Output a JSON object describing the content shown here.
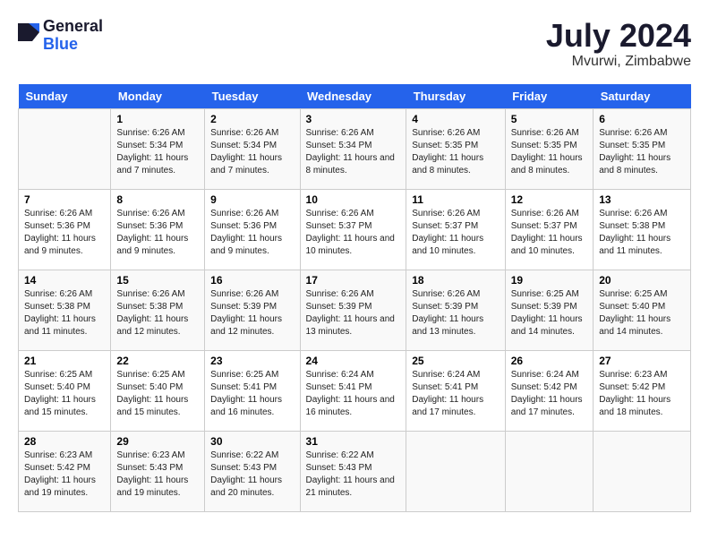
{
  "header": {
    "logo_general": "General",
    "logo_blue": "Blue",
    "month_year": "July 2024",
    "location": "Mvurwi, Zimbabwe"
  },
  "days_of_week": [
    "Sunday",
    "Monday",
    "Tuesday",
    "Wednesday",
    "Thursday",
    "Friday",
    "Saturday"
  ],
  "weeks": [
    [
      {
        "day": "",
        "sunrise": "",
        "sunset": "",
        "daylight": ""
      },
      {
        "day": "1",
        "sunrise": "Sunrise: 6:26 AM",
        "sunset": "Sunset: 5:34 PM",
        "daylight": "Daylight: 11 hours and 7 minutes."
      },
      {
        "day": "2",
        "sunrise": "Sunrise: 6:26 AM",
        "sunset": "Sunset: 5:34 PM",
        "daylight": "Daylight: 11 hours and 7 minutes."
      },
      {
        "day": "3",
        "sunrise": "Sunrise: 6:26 AM",
        "sunset": "Sunset: 5:34 PM",
        "daylight": "Daylight: 11 hours and 8 minutes."
      },
      {
        "day": "4",
        "sunrise": "Sunrise: 6:26 AM",
        "sunset": "Sunset: 5:35 PM",
        "daylight": "Daylight: 11 hours and 8 minutes."
      },
      {
        "day": "5",
        "sunrise": "Sunrise: 6:26 AM",
        "sunset": "Sunset: 5:35 PM",
        "daylight": "Daylight: 11 hours and 8 minutes."
      },
      {
        "day": "6",
        "sunrise": "Sunrise: 6:26 AM",
        "sunset": "Sunset: 5:35 PM",
        "daylight": "Daylight: 11 hours and 8 minutes."
      }
    ],
    [
      {
        "day": "7",
        "sunrise": "Sunrise: 6:26 AM",
        "sunset": "Sunset: 5:36 PM",
        "daylight": "Daylight: 11 hours and 9 minutes."
      },
      {
        "day": "8",
        "sunrise": "Sunrise: 6:26 AM",
        "sunset": "Sunset: 5:36 PM",
        "daylight": "Daylight: 11 hours and 9 minutes."
      },
      {
        "day": "9",
        "sunrise": "Sunrise: 6:26 AM",
        "sunset": "Sunset: 5:36 PM",
        "daylight": "Daylight: 11 hours and 9 minutes."
      },
      {
        "day": "10",
        "sunrise": "Sunrise: 6:26 AM",
        "sunset": "Sunset: 5:37 PM",
        "daylight": "Daylight: 11 hours and 10 minutes."
      },
      {
        "day": "11",
        "sunrise": "Sunrise: 6:26 AM",
        "sunset": "Sunset: 5:37 PM",
        "daylight": "Daylight: 11 hours and 10 minutes."
      },
      {
        "day": "12",
        "sunrise": "Sunrise: 6:26 AM",
        "sunset": "Sunset: 5:37 PM",
        "daylight": "Daylight: 11 hours and 10 minutes."
      },
      {
        "day": "13",
        "sunrise": "Sunrise: 6:26 AM",
        "sunset": "Sunset: 5:38 PM",
        "daylight": "Daylight: 11 hours and 11 minutes."
      }
    ],
    [
      {
        "day": "14",
        "sunrise": "Sunrise: 6:26 AM",
        "sunset": "Sunset: 5:38 PM",
        "daylight": "Daylight: 11 hours and 11 minutes."
      },
      {
        "day": "15",
        "sunrise": "Sunrise: 6:26 AM",
        "sunset": "Sunset: 5:38 PM",
        "daylight": "Daylight: 11 hours and 12 minutes."
      },
      {
        "day": "16",
        "sunrise": "Sunrise: 6:26 AM",
        "sunset": "Sunset: 5:39 PM",
        "daylight": "Daylight: 11 hours and 12 minutes."
      },
      {
        "day": "17",
        "sunrise": "Sunrise: 6:26 AM",
        "sunset": "Sunset: 5:39 PM",
        "daylight": "Daylight: 11 hours and 13 minutes."
      },
      {
        "day": "18",
        "sunrise": "Sunrise: 6:26 AM",
        "sunset": "Sunset: 5:39 PM",
        "daylight": "Daylight: 11 hours and 13 minutes."
      },
      {
        "day": "19",
        "sunrise": "Sunrise: 6:25 AM",
        "sunset": "Sunset: 5:39 PM",
        "daylight": "Daylight: 11 hours and 14 minutes."
      },
      {
        "day": "20",
        "sunrise": "Sunrise: 6:25 AM",
        "sunset": "Sunset: 5:40 PM",
        "daylight": "Daylight: 11 hours and 14 minutes."
      }
    ],
    [
      {
        "day": "21",
        "sunrise": "Sunrise: 6:25 AM",
        "sunset": "Sunset: 5:40 PM",
        "daylight": "Daylight: 11 hours and 15 minutes."
      },
      {
        "day": "22",
        "sunrise": "Sunrise: 6:25 AM",
        "sunset": "Sunset: 5:40 PM",
        "daylight": "Daylight: 11 hours and 15 minutes."
      },
      {
        "day": "23",
        "sunrise": "Sunrise: 6:25 AM",
        "sunset": "Sunset: 5:41 PM",
        "daylight": "Daylight: 11 hours and 16 minutes."
      },
      {
        "day": "24",
        "sunrise": "Sunrise: 6:24 AM",
        "sunset": "Sunset: 5:41 PM",
        "daylight": "Daylight: 11 hours and 16 minutes."
      },
      {
        "day": "25",
        "sunrise": "Sunrise: 6:24 AM",
        "sunset": "Sunset: 5:41 PM",
        "daylight": "Daylight: 11 hours and 17 minutes."
      },
      {
        "day": "26",
        "sunrise": "Sunrise: 6:24 AM",
        "sunset": "Sunset: 5:42 PM",
        "daylight": "Daylight: 11 hours and 17 minutes."
      },
      {
        "day": "27",
        "sunrise": "Sunrise: 6:23 AM",
        "sunset": "Sunset: 5:42 PM",
        "daylight": "Daylight: 11 hours and 18 minutes."
      }
    ],
    [
      {
        "day": "28",
        "sunrise": "Sunrise: 6:23 AM",
        "sunset": "Sunset: 5:42 PM",
        "daylight": "Daylight: 11 hours and 19 minutes."
      },
      {
        "day": "29",
        "sunrise": "Sunrise: 6:23 AM",
        "sunset": "Sunset: 5:43 PM",
        "daylight": "Daylight: 11 hours and 19 minutes."
      },
      {
        "day": "30",
        "sunrise": "Sunrise: 6:22 AM",
        "sunset": "Sunset: 5:43 PM",
        "daylight": "Daylight: 11 hours and 20 minutes."
      },
      {
        "day": "31",
        "sunrise": "Sunrise: 6:22 AM",
        "sunset": "Sunset: 5:43 PM",
        "daylight": "Daylight: 11 hours and 21 minutes."
      },
      {
        "day": "",
        "sunrise": "",
        "sunset": "",
        "daylight": ""
      },
      {
        "day": "",
        "sunrise": "",
        "sunset": "",
        "daylight": ""
      },
      {
        "day": "",
        "sunrise": "",
        "sunset": "",
        "daylight": ""
      }
    ]
  ]
}
